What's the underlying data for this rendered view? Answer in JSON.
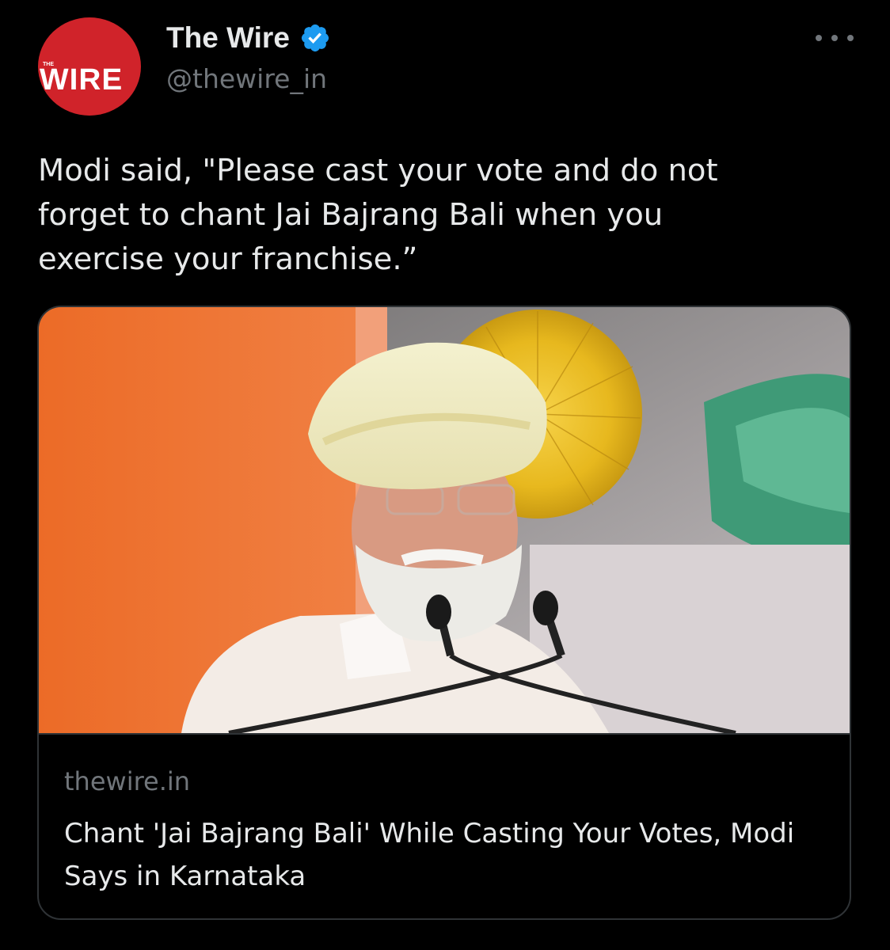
{
  "tweet": {
    "author": {
      "display_name": "The Wire",
      "handle": "@thewire_in",
      "verified": true,
      "avatar": {
        "small_text": "THE",
        "logo_text": "WIRE",
        "color": "#d0232a"
      }
    },
    "more_icon": "more-horizontal-icon",
    "text": "Modi said, \"Please cast your vote and do not\nforget to chant Jai Bajrang Bali when you\nexercise your franchise.”",
    "card": {
      "domain": "thewire.in",
      "title": "Chant 'Jai Bajrang Bali' While Casting Your Votes, Modi Says in Karnataka"
    }
  },
  "colors": {
    "background": "#000000",
    "text_primary": "#e7e9ea",
    "text_secondary": "#71767b",
    "border": "#2f3336",
    "verified": "#1d9bf0"
  }
}
